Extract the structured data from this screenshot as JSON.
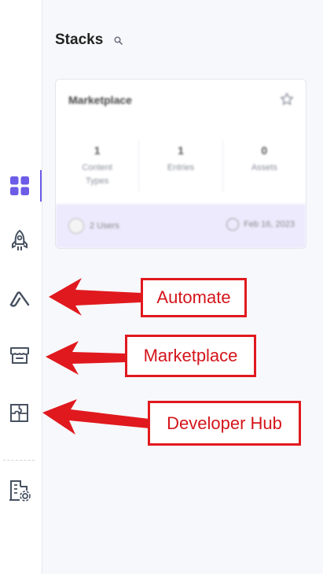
{
  "sidebar": {
    "items": [
      {
        "name": "stacks",
        "icon": "grid-icon"
      },
      {
        "name": "launch",
        "icon": "rocket-icon"
      },
      {
        "name": "automate",
        "icon": "automate-icon"
      },
      {
        "name": "marketplace",
        "icon": "store-icon"
      },
      {
        "name": "developer-hub",
        "icon": "puzzle-icon"
      },
      {
        "name": "org-settings",
        "icon": "building-settings-icon"
      }
    ],
    "active_color": "#6c5ce7"
  },
  "header": {
    "title": "Stacks"
  },
  "stack_card": {
    "name": "Marketplace",
    "stats": [
      {
        "value": "1",
        "label_line1": "Content",
        "label_line2": "Types"
      },
      {
        "value": "1",
        "label_line1": "Entries",
        "label_line2": ""
      },
      {
        "value": "0",
        "label_line1": "Assets",
        "label_line2": ""
      }
    ],
    "users": "2 Users",
    "date": "Feb 16, 2023"
  },
  "annotations": {
    "automate": "Automate",
    "marketplace": "Marketplace",
    "developer_hub": "Developer Hub",
    "color": "#e0191e"
  }
}
